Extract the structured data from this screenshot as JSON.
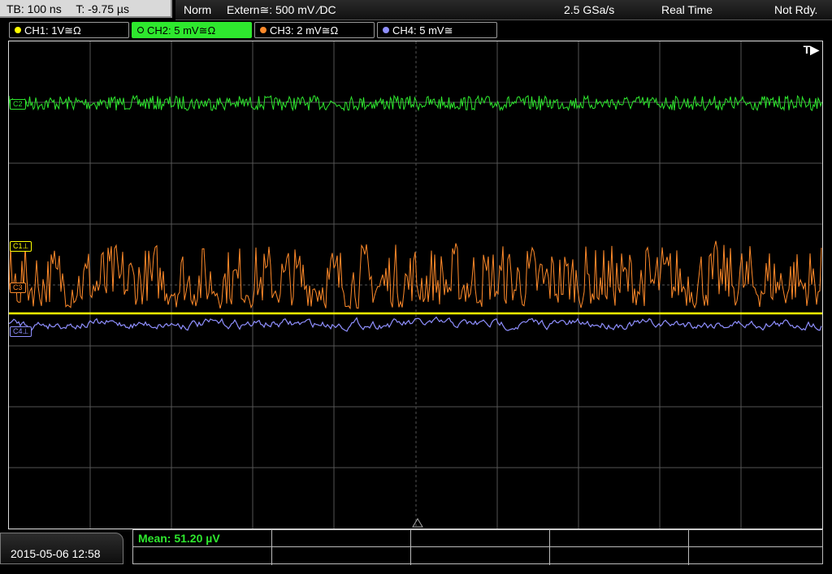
{
  "header": {
    "timebase": "TB: 100 ns",
    "trigger_pos": "T: -9.75 µs",
    "mode": "Norm",
    "trigger": "Extern≅: 500 mV ⁄DC",
    "sample_rate": "2.5 GSa/s",
    "acq_mode": "Real Time",
    "status": "Not Rdy."
  },
  "channels": [
    {
      "label": "CH1: 1V≅Ω",
      "color": "#ffff00",
      "selected": false
    },
    {
      "label": "CH2: 5 mV≅Ω",
      "color": "#2ee82e",
      "selected": true
    },
    {
      "label": "CH3: 2 mV≅Ω",
      "color": "#ff8a2a",
      "selected": false
    },
    {
      "label": "CH4: 5 mV≅",
      "color": "#8f8fff",
      "selected": false
    }
  ],
  "trigger_marker": "T▶",
  "markers": {
    "c2": "C2",
    "c1": "C1⊥",
    "c3": "C3",
    "c4": "C4⊥"
  },
  "footer": {
    "datetime": "2015-05-06 12:58",
    "measurement": "Mean: 51.20 µV"
  },
  "colors": {
    "ch1": "#ffff00",
    "ch2": "#2ee82e",
    "ch3": "#ff8a2a",
    "ch4": "#8f8fff",
    "grid": "#555555"
  }
}
